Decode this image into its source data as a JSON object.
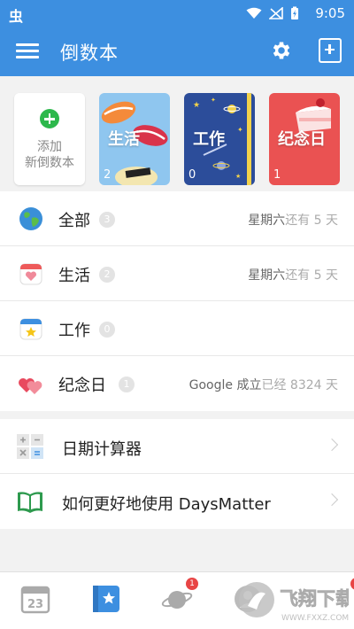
{
  "statusbar": {
    "logo": "虫",
    "time": "9:05"
  },
  "appbar": {
    "title": "倒数本"
  },
  "books": {
    "add_label_line1": "添加",
    "add_label_line2": "新倒数本",
    "items": [
      {
        "name": "生活",
        "count": "2"
      },
      {
        "name": "工作",
        "count": "0"
      },
      {
        "name": "纪念日",
        "count": "1"
      }
    ]
  },
  "list": [
    {
      "label": "全部",
      "badge": "3",
      "weekday": "星期六",
      "suffix": "还有 5 天"
    },
    {
      "label": "生活",
      "badge": "2",
      "weekday": "星期六",
      "suffix": "还有 5 天"
    },
    {
      "label": "工作",
      "badge": "0",
      "weekday": "",
      "suffix": ""
    },
    {
      "label": "纪念日",
      "badge": "1",
      "weekday": "Google 成立",
      "suffix": "已经 8324 天"
    }
  ],
  "tools": [
    {
      "label": "日期计算器"
    },
    {
      "label": "如何更好地使用 DaysMatter"
    }
  ],
  "tabbar": {
    "calendar_day": "23",
    "badge_planet": "1",
    "badge_last": "1"
  },
  "watermark": {
    "text": "飞翔下载",
    "url": "WWW.FXXZ.COM"
  },
  "colors": {
    "primary": "#3d8fe0",
    "green": "#2db84c",
    "red": "#ea5252",
    "navy": "#2c4d9a",
    "sky": "#8fc6ef"
  }
}
